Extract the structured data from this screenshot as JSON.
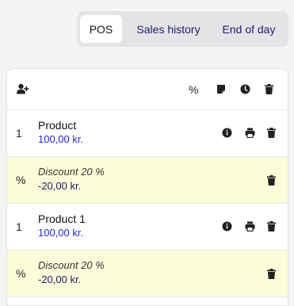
{
  "tabs": [
    {
      "label": "POS",
      "active": true
    },
    {
      "label": "Sales history",
      "active": false
    },
    {
      "label": "End of day",
      "active": false
    }
  ],
  "header": {
    "percent_label": "%",
    "icons": [
      "add-customer-icon",
      "note-icon",
      "clock-icon",
      "trash-icon"
    ]
  },
  "rows": [
    {
      "type": "product",
      "qty": "1",
      "name": "Product",
      "price": "100,00 kr."
    },
    {
      "type": "discount",
      "lead": "%",
      "name": "Discount 20 %",
      "price": "-20,00 kr."
    },
    {
      "type": "product",
      "qty": "1",
      "name": "Product 1",
      "price": "100,00 kr."
    },
    {
      "type": "discount",
      "lead": "%",
      "name": "Discount 20 %",
      "price": "-20,00 kr."
    }
  ],
  "colors": {
    "price": "#2525d4",
    "discount_bg": "#fbfdd9",
    "tab_text": "#1f1b6e"
  }
}
